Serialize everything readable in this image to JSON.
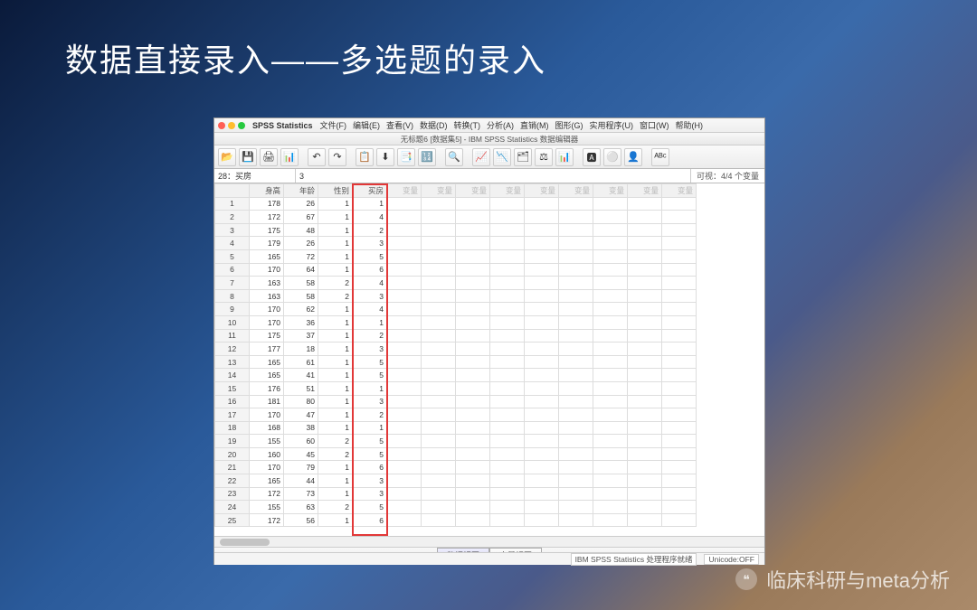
{
  "slide_title": "数据直接录入——多选题的录入",
  "menubar": {
    "app": "SPSS Statistics",
    "items": [
      "文件(F)",
      "编辑(E)",
      "查看(V)",
      "数据(D)",
      "转换(T)",
      "分析(A)",
      "直销(M)",
      "图形(G)",
      "实用程序(U)",
      "窗口(W)",
      "帮助(H)"
    ]
  },
  "window_title": "无标题6 [数据集5] - IBM SPSS Statistics 数据编辑器",
  "toolbar_icons": [
    "📂",
    "💾",
    "🖨",
    "📊",
    "↶",
    "↷",
    "📋",
    "⬇",
    "📑",
    "🔢",
    "🔍",
    "📈",
    "📉",
    "🗂",
    "⚖",
    "📊",
    "🅰",
    "⚪",
    "👤",
    "ᴬᴮᶜ"
  ],
  "cellref": {
    "name": "28：买房",
    "value": "3",
    "visible": "可视：4/4 个变量"
  },
  "columns": [
    "身高",
    "年龄",
    "性别",
    "买房",
    "变量",
    "变量",
    "变量",
    "变量",
    "变量",
    "变量",
    "变量",
    "变量",
    "变量"
  ],
  "rows": [
    {
      "n": 1,
      "v": [
        178,
        26,
        1,
        1
      ]
    },
    {
      "n": 2,
      "v": [
        172,
        67,
        1,
        4
      ]
    },
    {
      "n": 3,
      "v": [
        175,
        48,
        1,
        2
      ]
    },
    {
      "n": 4,
      "v": [
        179,
        26,
        1,
        3
      ]
    },
    {
      "n": 5,
      "v": [
        165,
        72,
        1,
        5
      ]
    },
    {
      "n": 6,
      "v": [
        170,
        64,
        1,
        6
      ]
    },
    {
      "n": 7,
      "v": [
        163,
        58,
        2,
        4
      ]
    },
    {
      "n": 8,
      "v": [
        163,
        58,
        2,
        3
      ]
    },
    {
      "n": 9,
      "v": [
        170,
        62,
        1,
        4
      ]
    },
    {
      "n": 10,
      "v": [
        170,
        36,
        1,
        1
      ]
    },
    {
      "n": 11,
      "v": [
        175,
        37,
        1,
        2
      ]
    },
    {
      "n": 12,
      "v": [
        177,
        18,
        1,
        3
      ]
    },
    {
      "n": 13,
      "v": [
        165,
        61,
        1,
        5
      ]
    },
    {
      "n": 14,
      "v": [
        165,
        41,
        1,
        5
      ]
    },
    {
      "n": 15,
      "v": [
        176,
        51,
        1,
        1
      ]
    },
    {
      "n": 16,
      "v": [
        181,
        80,
        1,
        3
      ]
    },
    {
      "n": 17,
      "v": [
        170,
        47,
        1,
        2
      ]
    },
    {
      "n": 18,
      "v": [
        168,
        38,
        1,
        1
      ]
    },
    {
      "n": 19,
      "v": [
        155,
        60,
        2,
        5
      ]
    },
    {
      "n": 20,
      "v": [
        160,
        45,
        2,
        5
      ]
    },
    {
      "n": 21,
      "v": [
        170,
        79,
        1,
        6
      ]
    },
    {
      "n": 22,
      "v": [
        165,
        44,
        1,
        3
      ]
    },
    {
      "n": 23,
      "v": [
        172,
        73,
        1,
        3
      ]
    },
    {
      "n": 24,
      "v": [
        155,
        63,
        2,
        5
      ]
    },
    {
      "n": 25,
      "v": [
        172,
        56,
        1,
        6
      ]
    }
  ],
  "view_tabs": {
    "data": "数据视图",
    "variable": "变量视图"
  },
  "statusbar": {
    "ready": "IBM SPSS Statistics 处理程序就绪",
    "unicode": "Unicode:OFF"
  },
  "watermark": "临床科研与meta分析"
}
